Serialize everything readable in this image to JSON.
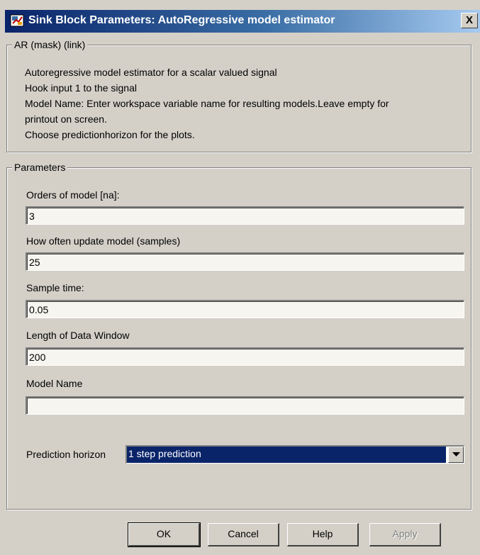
{
  "window": {
    "title": "Sink Block Parameters: AutoRegressive model estimator",
    "close_glyph": "X"
  },
  "description_box": {
    "legend": "AR (mask) (link)",
    "lines": [
      "Autoregressive model estimator for a scalar valued signal",
      "Hook input 1 to the signal",
      "Model Name: Enter workspace variable name for resulting models.Leave empty for",
      "printout on screen.",
      "Choose predictionhorizon for the plots."
    ]
  },
  "parameters": {
    "legend": "Parameters",
    "fields": [
      {
        "label": "Orders of model [na]:",
        "value": "3"
      },
      {
        "label": "How often update model (samples)",
        "value": "25"
      },
      {
        "label": "Sample time:",
        "value": "0.05"
      },
      {
        "label": "Length of Data Window",
        "value": "200"
      },
      {
        "label": "Model Name",
        "value": ""
      }
    ],
    "prediction": {
      "label": "Prediction horizon",
      "selected": "1 step prediction"
    }
  },
  "buttons": {
    "ok": "OK",
    "cancel": "Cancel",
    "help": "Help",
    "apply": "Apply"
  },
  "colors": {
    "title_bar_start": "#0a246a",
    "title_bar_end": "#a6caf0",
    "dialog_background": "#d4d0c8",
    "selection_highlight": "#0a246a"
  },
  "icons": {
    "window_icon": "simulink-block-icon",
    "close": "close-icon",
    "dropdown": "chevron-down-icon"
  }
}
